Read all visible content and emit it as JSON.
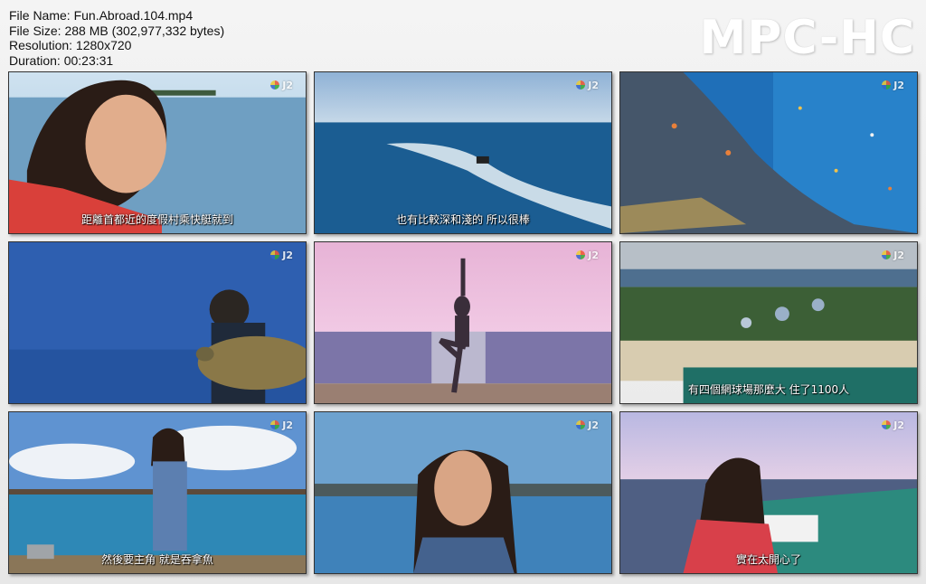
{
  "file_info": {
    "name_line": "File Name: Fun.Abroad.104.mp4",
    "size_line": "File Size: 288 MB (302,977,332 bytes)",
    "resolution_line": "Resolution: 1280x720",
    "duration_line": "Duration: 00:23:31"
  },
  "watermark": "MPC-HC",
  "channel_logo": "J2",
  "thumbnails": [
    {
      "scene": "woman-laughing-on-boat",
      "subtitle": "距離首都近的度假村乘快艇就到"
    },
    {
      "scene": "jet-ski-on-ocean",
      "subtitle": "也有比較深和淺的 所以很棒"
    },
    {
      "scene": "coral-reef-fish",
      "subtitle": ""
    },
    {
      "scene": "diver-with-turtle",
      "subtitle": ""
    },
    {
      "scene": "yoga-pose-at-sunset",
      "subtitle": ""
    },
    {
      "scene": "aerial-island-village",
      "subtitle": "有四個網球場那麼大 住了1100人"
    },
    {
      "scene": "woman-cooking-outdoors",
      "subtitle": "然後要主角 就是吞拿魚"
    },
    {
      "scene": "woman-smiling-water-villas",
      "subtitle": ""
    },
    {
      "scene": "woman-on-boat-deck",
      "subtitle": "實在太開心了"
    }
  ]
}
